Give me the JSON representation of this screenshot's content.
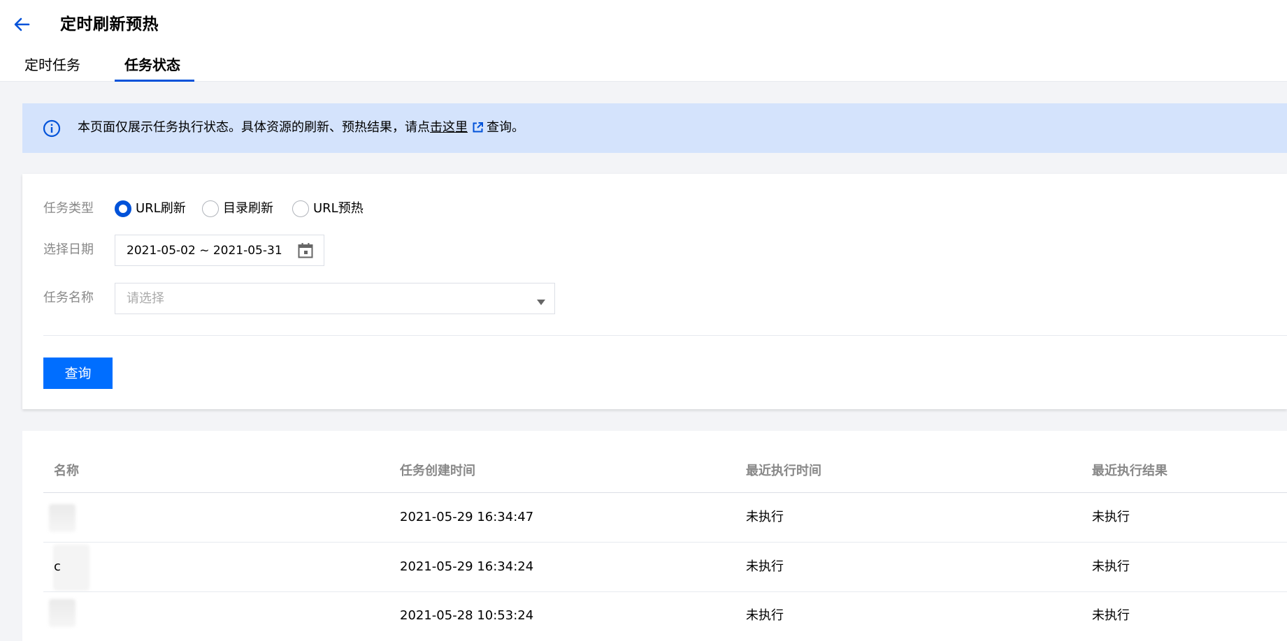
{
  "header": {
    "title": "定时刷新预热",
    "tabs": [
      {
        "label": "定时任务",
        "active": false
      },
      {
        "label": "任务状态",
        "active": true
      }
    ]
  },
  "banner": {
    "text_before": "本页面仅展示任务执行状态。具体资源的刷新、预热结果，请点",
    "link_text": "击这里",
    "text_after": "查询。"
  },
  "filters": {
    "task_type": {
      "label": "任务类型",
      "options": [
        "URL刷新",
        "目录刷新",
        "URL预热"
      ],
      "selected": "URL刷新"
    },
    "date": {
      "label": "选择日期",
      "value": "2021-05-02 ~ 2021-05-31"
    },
    "task_name": {
      "label": "任务名称",
      "placeholder": "请选择"
    },
    "query_label": "查询"
  },
  "table": {
    "columns": [
      "名称",
      "任务创建时间",
      "最近执行时间",
      "最近执行结果"
    ],
    "rows": [
      {
        "name": "",
        "created": "2021-05-29 16:34:47",
        "last_run": "未执行",
        "result": "未执行"
      },
      {
        "name": "c",
        "created": "2021-05-29 16:34:24",
        "last_run": "未执行",
        "result": "未执行"
      },
      {
        "name": "",
        "created": "2021-05-28 10:53:24",
        "last_run": "未执行",
        "result": "未执行"
      }
    ]
  },
  "colors": {
    "primary": "#006eff",
    "tab_active": "#0052d9",
    "banner_bg": "#d4e3fc",
    "page_bg": "#f3f4f7"
  }
}
